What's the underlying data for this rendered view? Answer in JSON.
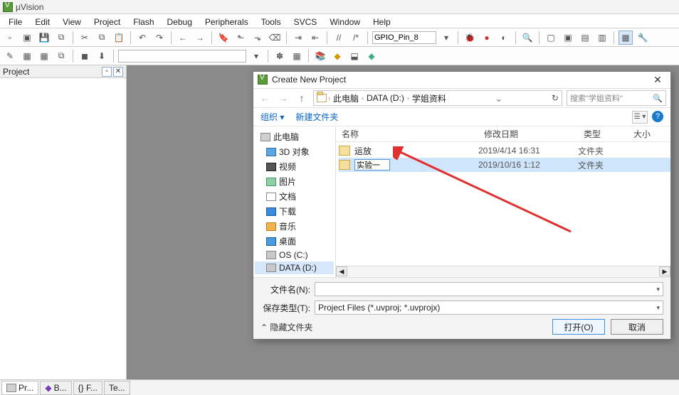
{
  "app": {
    "title": "µVision"
  },
  "menu": [
    "File",
    "Edit",
    "View",
    "Project",
    "Flash",
    "Debug",
    "Peripherals",
    "Tools",
    "SVCS",
    "Window",
    "Help"
  ],
  "toolbar1": {
    "search": "GPIO_Pin_8"
  },
  "project_panel": {
    "title": "Project"
  },
  "status_tabs": [
    "Pr...",
    "B...",
    "{} F...",
    "Te..."
  ],
  "dialog": {
    "title": "Create New Project",
    "path_segments": [
      "此电脑",
      "DATA (D:)",
      "学姐资料"
    ],
    "search_placeholder": "搜索\"学姐资料\"",
    "cmd_organize": "组织 ▾",
    "cmd_newfolder": "新建文件夹",
    "columns": {
      "name": "名称",
      "date": "修改日期",
      "type": "类型",
      "size": "大小"
    },
    "tree": [
      {
        "label": "此电脑",
        "icon": "pc",
        "level": 1
      },
      {
        "label": "3D 对象",
        "icon": "cube",
        "level": 2
      },
      {
        "label": "视频",
        "icon": "vid",
        "level": 2
      },
      {
        "label": "图片",
        "icon": "pic",
        "level": 2
      },
      {
        "label": "文档",
        "icon": "doc",
        "level": 2
      },
      {
        "label": "下载",
        "icon": "dl",
        "level": 2
      },
      {
        "label": "音乐",
        "icon": "mus",
        "level": 2
      },
      {
        "label": "桌面",
        "icon": "desk",
        "level": 2
      },
      {
        "label": "OS (C:)",
        "icon": "drv",
        "level": 2
      },
      {
        "label": "DATA (D:)",
        "icon": "drv",
        "level": 2,
        "sel": true
      }
    ],
    "files": [
      {
        "name": "实验一",
        "editing": true,
        "date": "2019/10/16 1:12",
        "type": "文件夹",
        "sel": true
      },
      {
        "name": "运放",
        "editing": false,
        "date": "2019/4/14 16:31",
        "type": "文件夹",
        "sel": false
      }
    ],
    "filename_label": "文件名(N):",
    "filetype_label": "保存类型(T):",
    "filetype_value": "Project Files (*.uvproj; *.uvprojx)",
    "hide_folders": "隐藏文件夹",
    "btn_open": "打开(O)",
    "btn_cancel": "取消"
  }
}
